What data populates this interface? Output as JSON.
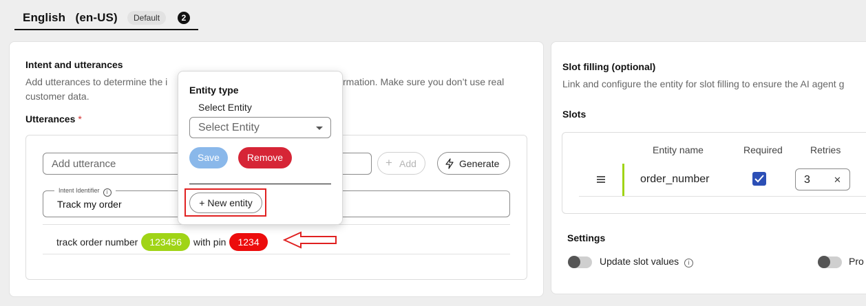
{
  "language_tab": {
    "name": "English   (en-US)",
    "badge": "Default",
    "count": "2"
  },
  "intent_card": {
    "title": "Intent and utterances",
    "desc_part1": "Add utterances to determine the i",
    "desc_part2": "rmation. Make sure you don’t use real",
    "desc_line2": "customer data.",
    "utterances_label": "Utterances",
    "required_mark": "*",
    "add_utterance_placeholder": "Add utterance",
    "add_button": "Add",
    "generate_button": "Generate",
    "intent_identifier_label": "Intent Identifier",
    "intent_identifier_value": "Track my order",
    "utterance": {
      "text1": "track order number",
      "chip1": "123456",
      "text2": "with pin",
      "chip2": "1234"
    }
  },
  "entity_popover": {
    "title": "Entity type",
    "select_label": "Select Entity",
    "select_placeholder": "Select Entity",
    "save_button": "Save",
    "remove_button": "Remove",
    "new_entity_button": "+ New entity"
  },
  "slot_card": {
    "title": "Slot filling (optional)",
    "desc": "Link and configure the entity for slot filling to ensure the AI agent g",
    "slots_label": "Slots",
    "columns": [
      "Entity name",
      "Required",
      "Retries"
    ],
    "rows": [
      {
        "entity_name": "order_number",
        "required": true,
        "retries": "3"
      }
    ],
    "settings_label": "Settings",
    "update_slot_values": "Update slot values",
    "prov_label": "Pro"
  },
  "colors": {
    "chip_green": "#a0d416",
    "chip_red": "#ec0c0c",
    "remove_red": "#d62536",
    "save_blue": "#8ab8ea",
    "checkbox_blue": "#2c4fb6"
  }
}
